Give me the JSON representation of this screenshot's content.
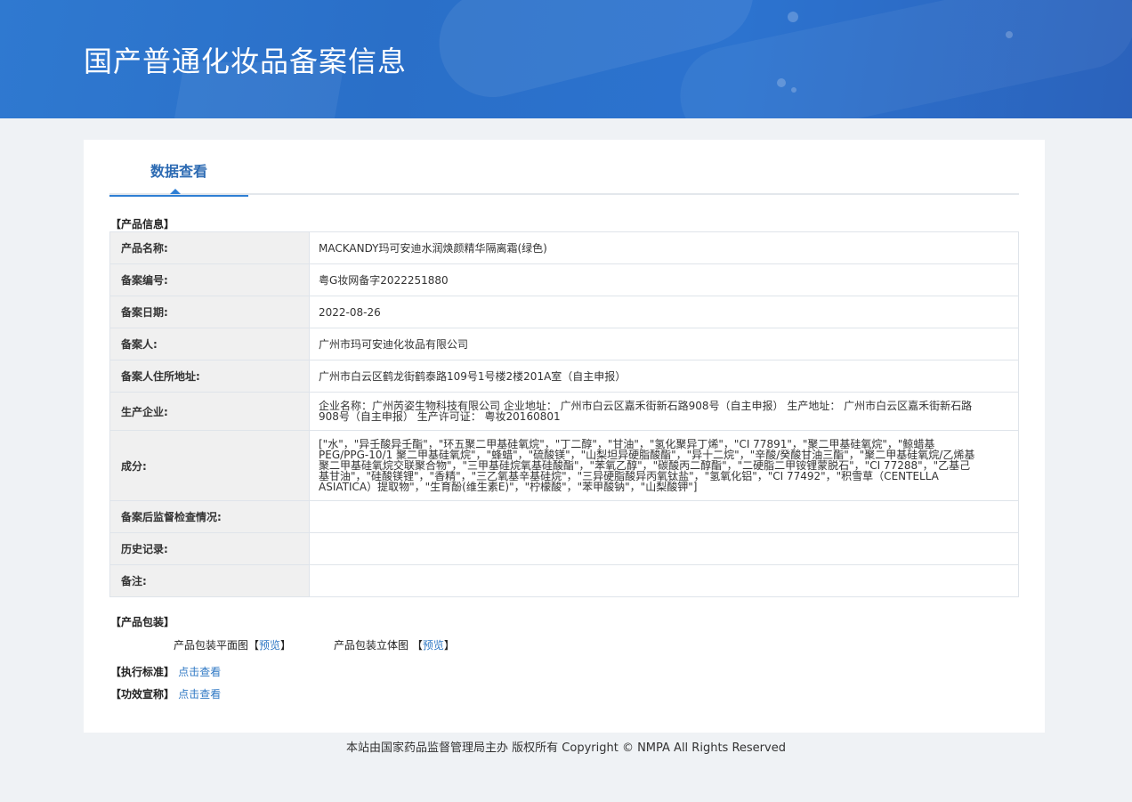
{
  "header": {
    "title": "国产普通化妆品备案信息"
  },
  "tabs": [
    {
      "label": "数据查看"
    }
  ],
  "product_info": {
    "section_label": "【产品信息】",
    "rows": [
      {
        "key": "产品名称:",
        "value": "MACKANDY玛可安迪水润焕颜精华隔离霜(绿色)"
      },
      {
        "key": "备案编号:",
        "value": "粤G妆网备字2022251880"
      },
      {
        "key": "备案日期:",
        "value": "2022-08-26"
      },
      {
        "key": "备案人:",
        "value": "广州市玛可安迪化妆品有限公司"
      },
      {
        "key": "备案人住所地址:",
        "value": "广州市白云区鹤龙街鹤泰路109号1号楼2楼201A室（自主申报）"
      },
      {
        "key": "生产企业:",
        "value": "企业名称：广州芮姿生物科技有限公司 企业地址： 广州市白云区嘉禾街新石路908号（自主申报） 生产地址： 广州市白云区嘉禾街新石路908号（自主申报） 生产许可证： 粤妆20160801"
      },
      {
        "key": "成分:",
        "value": "[\"水\"，\"异壬酸异壬酯\"，\"环五聚二甲基硅氧烷\"，\"丁二醇\"，\"甘油\"，\"氢化聚异丁烯\"，\"CI 77891\"，\"聚二甲基硅氧烷\"，\"鲸蜡基PEG/PPG-10/1 聚二甲基硅氧烷\"，\"蜂蜡\"，\"硫酸镁\"，\"山梨坦异硬脂酸酯\"，\"异十二烷\"，\"辛酸/癸酸甘油三酯\"，\"聚二甲基硅氧烷/乙烯基聚二甲基硅氧烷交联聚合物\"，\"三甲基硅烷氧基硅酸酯\"，\"苯氧乙醇\"，\"碳酸丙二醇酯\"，\"二硬脂二甲铵锂蒙脱石\"，\"CI 77288\"，\"乙基己基甘油\"，\"硅酸镁锂\"，\"香精\"，\"三乙氧基辛基硅烷\"，\"三异硬脂酸异丙氧钛盐\"，\"氢氧化铝\"，\"CI 77492\"，\"积雪草（CENTELLA ASIATICA）提取物\"，\"生育酚(维生素E)\"，\"柠檬酸\"，\"苯甲酸钠\"，\"山梨酸钾\"]"
      },
      {
        "key": "备案后监督检查情况:",
        "value": ""
      },
      {
        "key": "历史记录:",
        "value": ""
      },
      {
        "key": "备注:",
        "value": ""
      }
    ]
  },
  "packaging": {
    "section_label": "【产品包装】",
    "flat": {
      "label": "产品包装平面图",
      "link": "预览"
    },
    "stereo": {
      "label": "产品包装立体图",
      "link": "预览"
    }
  },
  "standard": {
    "label": "【执行标准】",
    "link": "点击查看"
  },
  "efficacy": {
    "label": "【功效宣称】",
    "link": "点击查看"
  },
  "footer": {
    "text": "本站由国家药品监督管理局主办 版权所有 Copyright © NMPA All Rights Reserved"
  },
  "colors": {
    "banner": "#2c70cb",
    "accent": "#2f7fd4",
    "link": "#2f78c4",
    "key_bg": "#f0f0f0"
  }
}
